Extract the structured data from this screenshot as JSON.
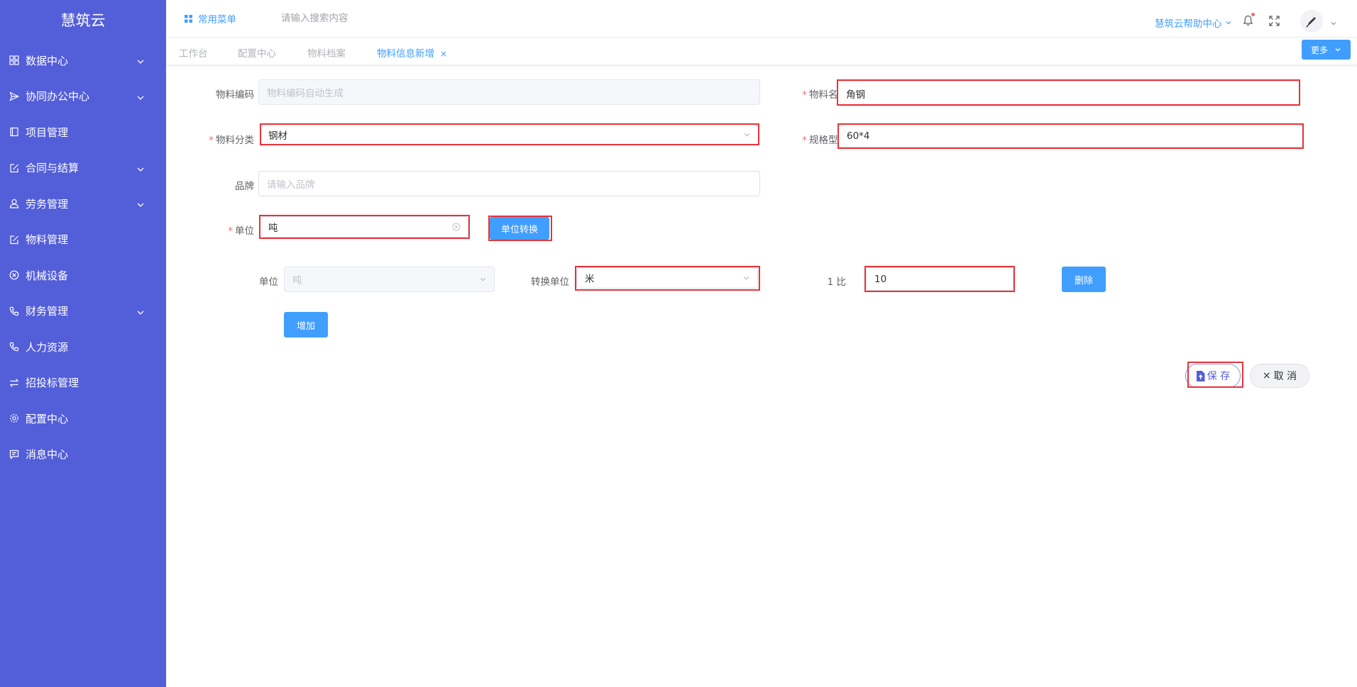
{
  "app": {
    "title": "慧筑云"
  },
  "sidebar": {
    "items": [
      {
        "label": "数据中心",
        "icon": "grid-icon",
        "expandable": true
      },
      {
        "label": "协同办公中心",
        "icon": "send-icon",
        "expandable": true
      },
      {
        "label": "项目管理",
        "icon": "book-icon",
        "expandable": false
      },
      {
        "label": "合同与结算",
        "icon": "edit-icon",
        "expandable": true
      },
      {
        "label": "劳务管理",
        "icon": "user-icon",
        "expandable": true
      },
      {
        "label": "物料管理",
        "icon": "edit-icon",
        "expandable": false
      },
      {
        "label": "机械设备",
        "icon": "circle-x-icon",
        "expandable": false
      },
      {
        "label": "财务管理",
        "icon": "phone-icon",
        "expandable": true
      },
      {
        "label": "人力资源",
        "icon": "phone-icon",
        "expandable": false
      },
      {
        "label": "招投标管理",
        "icon": "exchange-icon",
        "expandable": false
      },
      {
        "label": "配置中心",
        "icon": "gear-icon",
        "expandable": false
      },
      {
        "label": "消息中心",
        "icon": "message-icon",
        "expandable": false
      }
    ]
  },
  "header": {
    "favorites_label": "常用菜单",
    "search_placeholder": "请输入搜索内容",
    "help_label": "慧筑云帮助中心",
    "more_label": "更多"
  },
  "tabs": [
    {
      "label": "工作台",
      "active": false
    },
    {
      "label": "配置中心",
      "active": false
    },
    {
      "label": "物料档案",
      "active": false
    },
    {
      "label": "物料信息新增",
      "active": true,
      "closable": true
    }
  ],
  "form": {
    "code": {
      "label": "物料编码",
      "placeholder": "物料编码自动生成"
    },
    "name": {
      "label": "物料名称",
      "value": "角钢",
      "required": true
    },
    "category": {
      "label": "物料分类",
      "value": "钢材",
      "required": true
    },
    "spec": {
      "label": "规格型号",
      "value": "60*4",
      "required": true
    },
    "brand": {
      "label": "品牌",
      "placeholder": "请输入品牌"
    },
    "unit": {
      "label": "单位",
      "value": "吨",
      "required": true
    },
    "convert_button": "单位转换",
    "conversion": {
      "unit_label": "单位",
      "unit_value": "吨",
      "target_label": "转换单位",
      "target_value": "米",
      "ratio_label": "1 比",
      "ratio_value": "10",
      "delete_button": "删除"
    },
    "add_button": "增加",
    "save_button": "保 存",
    "cancel_button": "取 消"
  },
  "colors": {
    "sidebar_bg": "#535ed9",
    "primary": "#409eff",
    "highlight_border": "#e8333a",
    "required": "#f56c6c"
  }
}
